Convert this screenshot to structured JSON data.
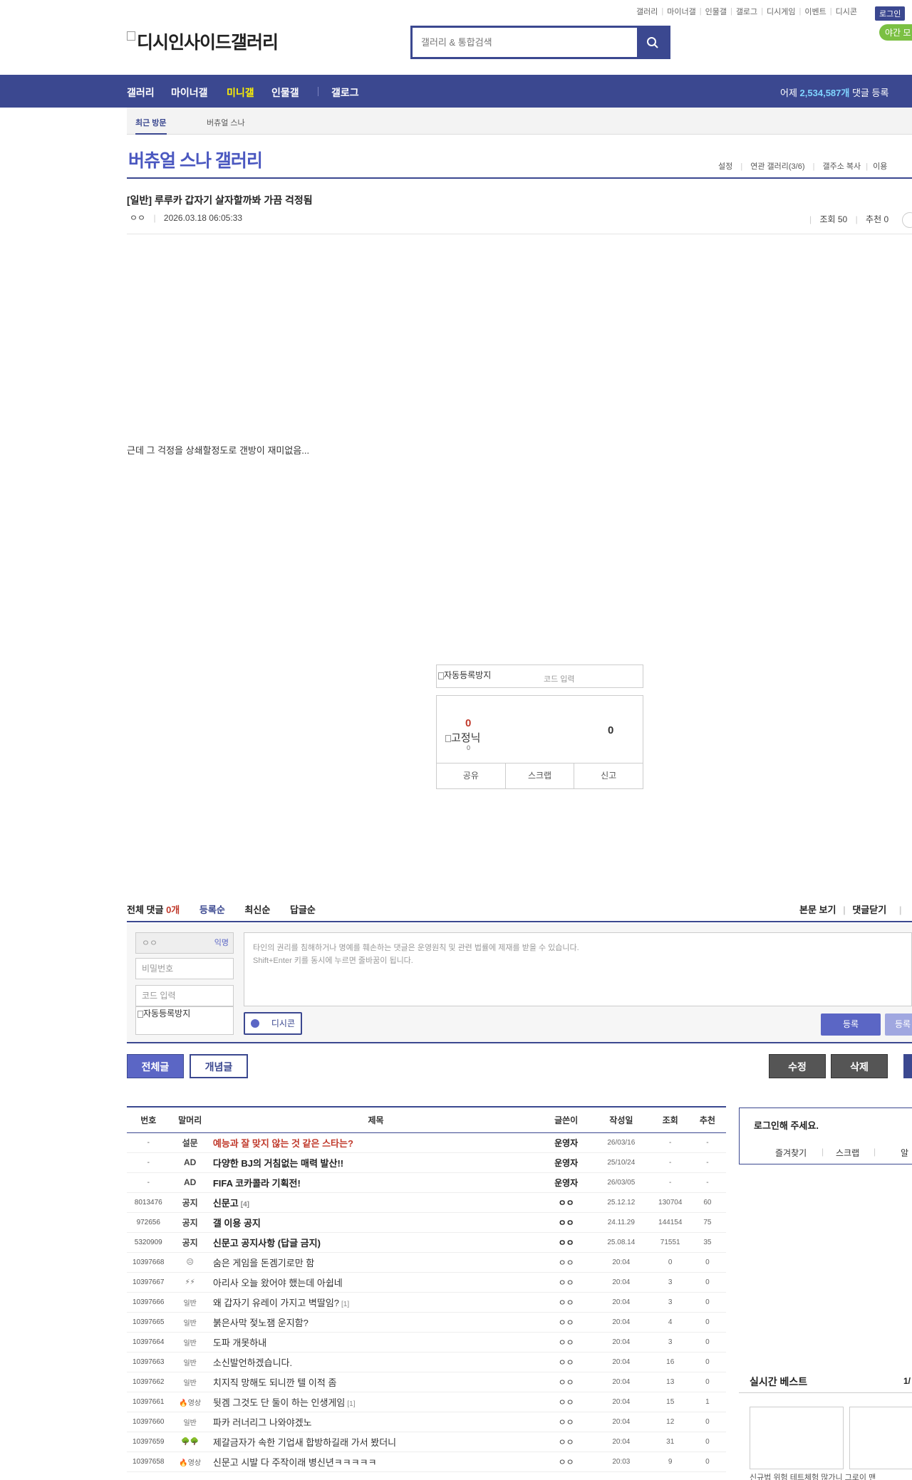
{
  "top_links": [
    "갤러리",
    "마이너갤",
    "인물갤",
    "갤로그",
    "디시게임",
    "이벤트",
    "디시콘"
  ],
  "login_label": "로그인",
  "night_mode_label": "야간 모",
  "logo_text": "디시인사이드갤러리",
  "search": {
    "placeholder": "갤러리 & 통합검색"
  },
  "gnb": {
    "items": [
      "갤러리",
      "마이너갤",
      "미니갤",
      "인물갤",
      "갤로그"
    ],
    "stat_prefix": "어제",
    "stat_count": "2,534,587개",
    "stat_suffix": "댓글 등록"
  },
  "recent": {
    "label": "최근 방문",
    "item": "버츄얼 스나"
  },
  "gallery_title": "버츄얼 스나 갤러리",
  "gallery_tools": [
    "설정",
    "연관 갤러리(3/6)",
    "갤주소 복사",
    "이용"
  ],
  "post": {
    "title": "[일반] 루루카 갑자기 살자할까봐 가끔 걱정됨",
    "author": "ㅇㅇ",
    "date": "2026.03.18 06:05:33",
    "views": "조회 50",
    "recommend": "추천 0",
    "body": "근데 그 걱정을 상쇄할정도로 갠방이 재미없음..."
  },
  "captcha": {
    "img_alt": "자동등록방지",
    "code_placeholder": "코드 입력"
  },
  "recommend_box": {
    "up": "0",
    "fixed_label": "고정닉",
    "fixed_count": "0",
    "down": "0",
    "buttons": [
      "공유",
      "스크랩",
      "신고"
    ]
  },
  "comments": {
    "label": "전체 댓글",
    "count": "0개",
    "sorts": [
      "등록순",
      "최신순",
      "답글순"
    ],
    "right": [
      "본문 보기",
      "댓글닫기"
    ],
    "nick_value": "ㅇㅇ",
    "anon_label": "익명",
    "password_placeholder": "비밀번호",
    "code_placeholder": "코드 입력",
    "captcha_alt": "자동등록방지",
    "textarea_placeholder_1": "타인의 권리를 침해하거나 명예를 훼손하는 댓글은 운영원칙 및 관련 법률에 제재를 받을 수 있습니다.",
    "textarea_placeholder_2": "Shift+Enter 키를 동시에 누르면 줄바꿈이 됩니다.",
    "dccon_label": "디시콘",
    "register_label": "등록",
    "register2_label": "등록"
  },
  "list_buttons": {
    "all": "전체글",
    "concept": "개념글",
    "edit": "수정",
    "delete": "삭제"
  },
  "table": {
    "headers": [
      "번호",
      "말머리",
      "제목",
      "글쓴이",
      "작성일",
      "조회",
      "추천"
    ],
    "rows": [
      {
        "num": "-",
        "head": "설문",
        "title": "예능과 잘 맞지 않는 것 같은 스타는?",
        "cc": "",
        "writer": "운영자",
        "date": "26/03/16",
        "views": "-",
        "rec": "-",
        "type": "hl"
      },
      {
        "num": "-",
        "head": "AD",
        "title": "다양한 BJ의 거침없는 매력 발산!!",
        "cc": "",
        "writer": "운영자",
        "date": "25/10/24",
        "views": "-",
        "rec": "-",
        "type": "notice"
      },
      {
        "num": "-",
        "head": "AD",
        "title": "FIFA 코카콜라 기획전!",
        "cc": "",
        "writer": "운영자",
        "date": "26/03/05",
        "views": "-",
        "rec": "-",
        "type": "notice"
      },
      {
        "num": "8013476",
        "head": "공지",
        "title": "신문고",
        "cc": "[4]",
        "writer": "ㅇㅇ",
        "date": "25.12.12",
        "views": "130704",
        "rec": "60",
        "type": "notice"
      },
      {
        "num": "972656",
        "head": "공지",
        "title": "갤 이용 공지",
        "cc": "",
        "writer": "ㅇㅇ",
        "date": "24.11.29",
        "views": "144154",
        "rec": "75",
        "type": "notice"
      },
      {
        "num": "5320909",
        "head": "공지",
        "title": "신문고 공지사항 (답글 금지)",
        "cc": "",
        "writer": "ㅇㅇ",
        "date": "25.08.14",
        "views": "71551",
        "rec": "35",
        "type": "notice"
      },
      {
        "num": "10397668",
        "head": "😐",
        "title": "숨은 게임을 돈겜기로만 함",
        "cc": "",
        "writer": "ㅇㅇ",
        "date": "20:04",
        "views": "0",
        "rec": "0",
        "type": ""
      },
      {
        "num": "10397667",
        "head": "⚡⚡",
        "title": "아리사 오늘 왔어야 했는데 아쉽네",
        "cc": "",
        "writer": "ㅇㅇ",
        "date": "20:04",
        "views": "3",
        "rec": "0",
        "type": ""
      },
      {
        "num": "10397666",
        "head": "일반",
        "title": "왜 갑자기 유레이 가지고 벽딸임?",
        "cc": "[1]",
        "writer": "ㅇㅇ",
        "date": "20:04",
        "views": "3",
        "rec": "0",
        "type": ""
      },
      {
        "num": "10397665",
        "head": "일반",
        "title": "붉은사막 젖노잼 운지함?",
        "cc": "",
        "writer": "ㅇㅇ",
        "date": "20:04",
        "views": "4",
        "rec": "0",
        "type": ""
      },
      {
        "num": "10397664",
        "head": "일반",
        "title": "도파 개못하내",
        "cc": "",
        "writer": "ㅇㅇ",
        "date": "20:04",
        "views": "3",
        "rec": "0",
        "type": ""
      },
      {
        "num": "10397663",
        "head": "일반",
        "title": "소신발언하겠습니다.",
        "cc": "",
        "writer": "ㅇㅇ",
        "date": "20:04",
        "views": "16",
        "rec": "0",
        "type": ""
      },
      {
        "num": "10397662",
        "head": "일반",
        "title": "치지직 망해도 되니깐 텔 이적 좀",
        "cc": "",
        "writer": "ㅇㅇ",
        "date": "20:04",
        "views": "13",
        "rec": "0",
        "type": ""
      },
      {
        "num": "10397661",
        "head": "🔥영상",
        "title": "뒷겜 그것도 단 둘이 하는 인생게임",
        "cc": "[1]",
        "writer": "ㅇㅇ",
        "date": "20:04",
        "views": "15",
        "rec": "1",
        "type": ""
      },
      {
        "num": "10397660",
        "head": "일반",
        "title": "파카 러너리그 나와야겠노",
        "cc": "",
        "writer": "ㅇㅇ",
        "date": "20:04",
        "views": "12",
        "rec": "0",
        "type": ""
      },
      {
        "num": "10397659",
        "head": "🌳🌳",
        "title": "제갈금자가 속한 기업새 합방하길래 가서 봤더니",
        "cc": "",
        "writer": "ㅇㅇ",
        "date": "20:04",
        "views": "31",
        "rec": "0",
        "type": ""
      },
      {
        "num": "10397658",
        "head": "🔥영상",
        "title": "신문고 시발 다 주작이래 병신년ㅋㅋㅋㅋㅋ",
        "cc": "",
        "writer": "ㅇㅇ",
        "date": "20:03",
        "views": "9",
        "rec": "0",
        "type": ""
      }
    ]
  },
  "side": {
    "login_prompt": "로그인해 주세요.",
    "login_links": [
      "즐겨찾기",
      "스크랩",
      "알"
    ],
    "best_title": "실시간 베스트",
    "best_page": "1/",
    "best_caption": "신규법 위험 테트체험   많가니 그로이 맨"
  },
  "colors": {
    "brand": "#3b4890",
    "accent": "#4b58c0",
    "highlight": "#fff200",
    "alert": "#c0392b"
  }
}
